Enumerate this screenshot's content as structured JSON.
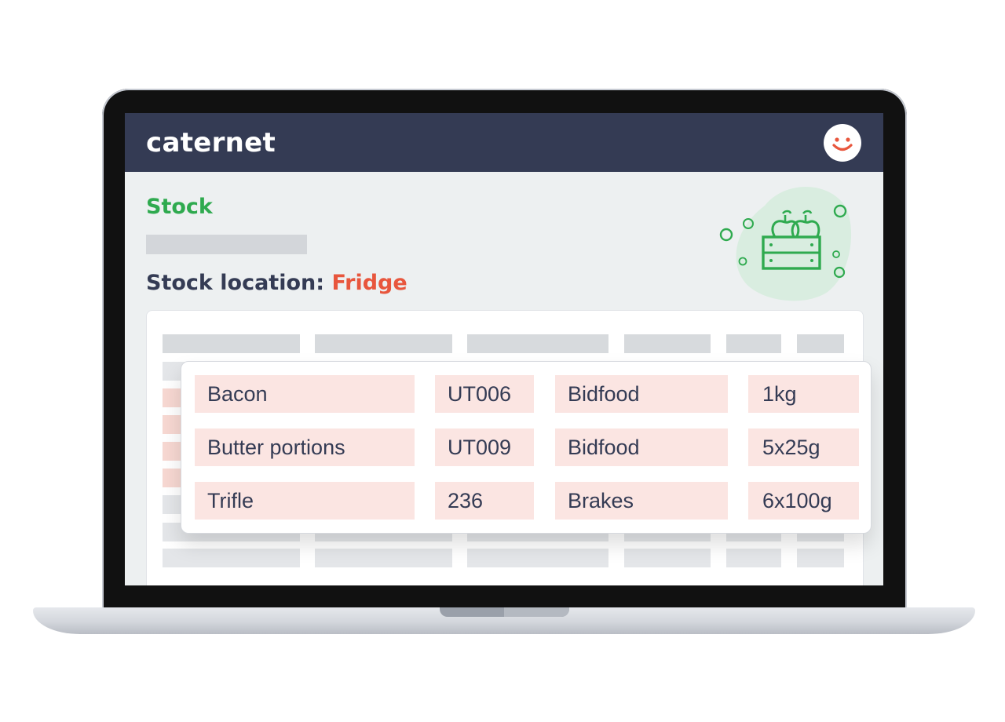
{
  "app": {
    "brand": "caternet"
  },
  "header": {
    "avatar_icon": "smiley-face-icon"
  },
  "page": {
    "section_title": "Stock",
    "location_label": "Stock location:",
    "location_value": "Fridge",
    "illustration_icon": "fruit-crate-icon"
  },
  "colors": {
    "topbar": "#343b54",
    "accent_green": "#2faa4f",
    "accent_red": "#e8563d",
    "row_highlight": "#fbe5e2"
  },
  "popup_rows": [
    {
      "name": "Bacon",
      "code": "UT006",
      "supplier": "Bidfood",
      "size": "1kg"
    },
    {
      "name": "Butter portions",
      "code": "UT009",
      "supplier": "Bidfood",
      "size": "5x25g"
    },
    {
      "name": "Trifle",
      "code": "236",
      "supplier": "Brakes",
      "size": "6x100g"
    }
  ]
}
